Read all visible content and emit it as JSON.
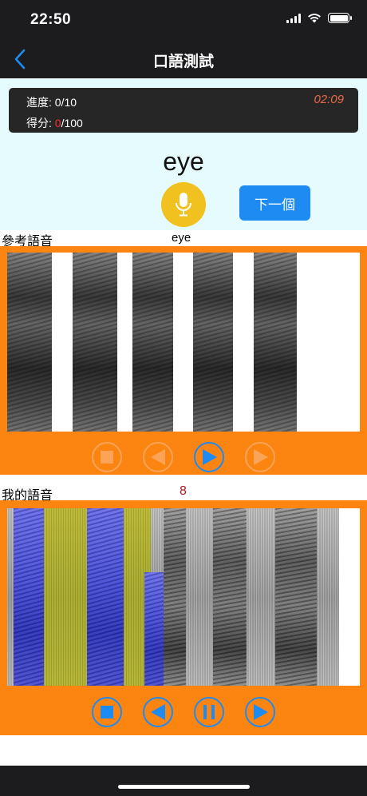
{
  "status_bar": {
    "time": "22:50"
  },
  "nav": {
    "title": "口語測試",
    "back_icon": "chevron-left-icon"
  },
  "info": {
    "progress_label": "進度: ",
    "progress_value": "0/10",
    "score_label": "得分: ",
    "score_value": "0",
    "score_total": "/100",
    "timer": "02:09"
  },
  "prompt": {
    "word": "eye"
  },
  "buttons": {
    "mic_icon": "microphone-icon",
    "next_label": "下一個"
  },
  "reference": {
    "label": "參考語音",
    "word": "eye"
  },
  "mine": {
    "label": "我的語音",
    "score": "8"
  },
  "controls": {
    "reference": [
      {
        "icon": "stop-icon",
        "enabled": false
      },
      {
        "icon": "rewind-icon",
        "enabled": false
      },
      {
        "icon": "play-icon",
        "enabled": true
      },
      {
        "icon": "forward-icon",
        "enabled": false
      }
    ],
    "mine": [
      {
        "icon": "stop-icon",
        "enabled": true
      },
      {
        "icon": "rewind-icon",
        "enabled": true
      },
      {
        "icon": "pause-icon",
        "enabled": true
      },
      {
        "icon": "play-icon",
        "enabled": true
      }
    ]
  },
  "colors": {
    "accent_blue": "#1e8bf3",
    "panel_orange": "#fc8511",
    "mic_yellow": "#f1c120",
    "timer_orange": "#e9684a",
    "score_red": "#b5131a",
    "highlight_blue": "#4a50d6",
    "highlight_yellow": "#a5a72a"
  }
}
